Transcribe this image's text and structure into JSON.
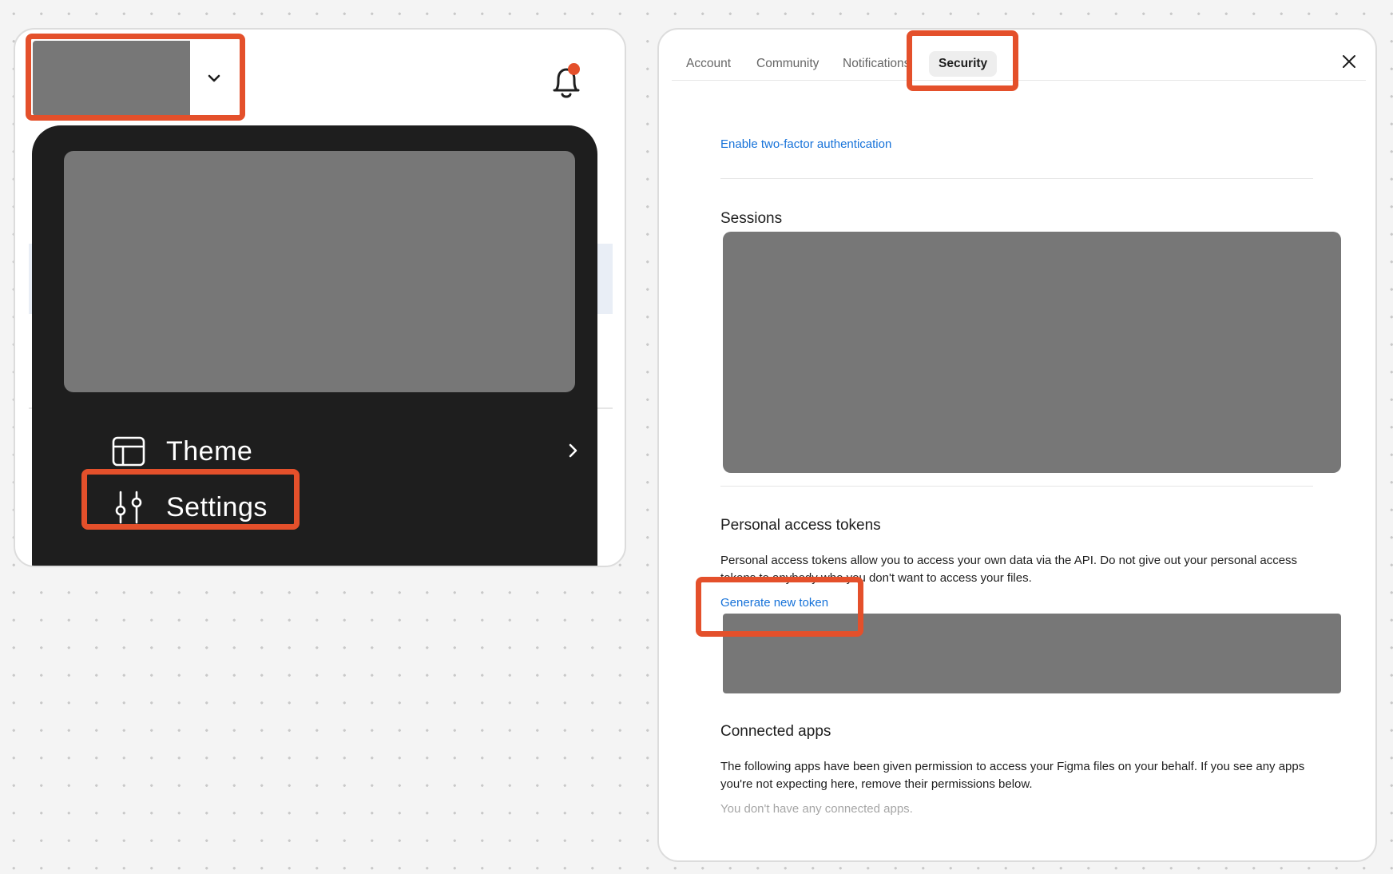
{
  "colors": {
    "highlight": "#e4502b",
    "link": "#1672d9",
    "menu_bg": "#1e1e1e",
    "redacted": "#777777",
    "notification_dot": "#e4502b"
  },
  "left_panel": {
    "account_switcher": {
      "icon": "chevron-down-icon"
    },
    "notifications": {
      "icon": "bell-icon",
      "has_unread": true
    },
    "menu": {
      "items": [
        {
          "label": "Theme",
          "icon": "layout-icon",
          "has_submenu": true
        },
        {
          "label": "Settings",
          "icon": "sliders-icon",
          "has_submenu": false
        }
      ]
    }
  },
  "settings_dialog": {
    "tabs": [
      {
        "label": "Account",
        "active": false
      },
      {
        "label": "Community",
        "active": false
      },
      {
        "label": "Notifications",
        "active": false
      },
      {
        "label": "Security",
        "active": true
      }
    ],
    "close_icon": "close-icon",
    "security": {
      "two_factor_link": "Enable two-factor authentication",
      "sessions_title": "Sessions",
      "tokens_title": "Personal access tokens",
      "tokens_description": "Personal access tokens allow you to access your own data via the API. Do not give out your personal access tokens to anybody who you don't want to access your files.",
      "generate_token_link": "Generate new token",
      "apps_title": "Connected apps",
      "apps_description": "The following apps have been given permission to access your Figma files on your behalf. If you see any apps you're not expecting here, remove their permissions below.",
      "apps_empty": "You don't have any connected apps."
    }
  }
}
